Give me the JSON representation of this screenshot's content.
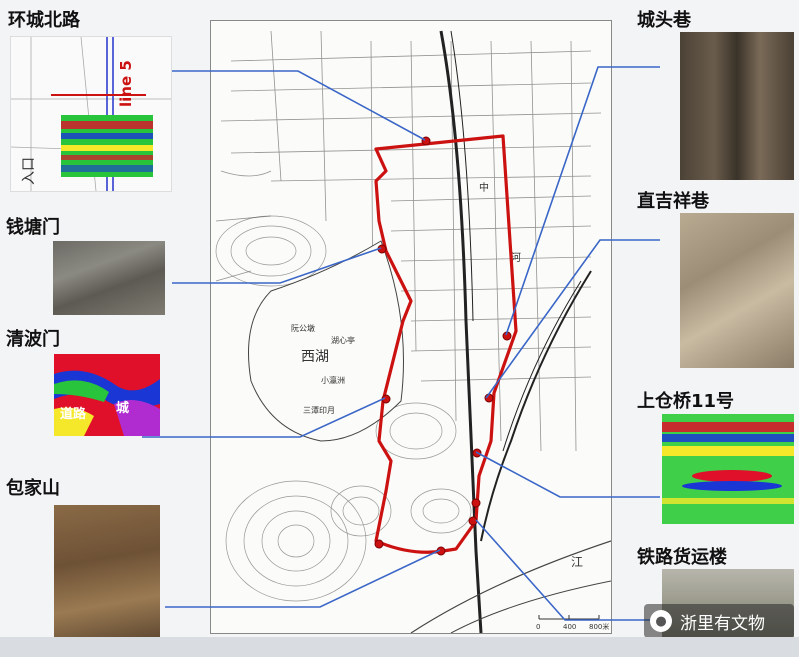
{
  "labels": {
    "huancheng": "环城北路",
    "qiantang": "钱塘门",
    "qingbo": "清波门",
    "baojia": "包家山",
    "chengtou": "城头巷",
    "zhiji": "直吉祥巷",
    "shangcang": "上仓桥11号",
    "tielu": "铁路货运楼"
  },
  "map": {
    "lake_name": "西湖",
    "places": [
      "阮公墩",
      "湖心亭",
      "小瀛洲",
      "三潭印月"
    ],
    "river_left": "中",
    "river_right": "河",
    "river_east": "江",
    "scale": [
      "0",
      "400",
      "800米"
    ]
  },
  "gpr": {
    "line_label": "line 5",
    "road_label": "道路",
    "wall_label": "城",
    "entrance_label": "入口"
  },
  "watermark": "浙里有文物",
  "colors": {
    "route": "#cc1111",
    "leader": "#3a66c8",
    "heat_red": "#e0102a",
    "heat_blue": "#1a37d6",
    "heat_yellow": "#f5e82a",
    "heat_green": "#28c43c"
  }
}
